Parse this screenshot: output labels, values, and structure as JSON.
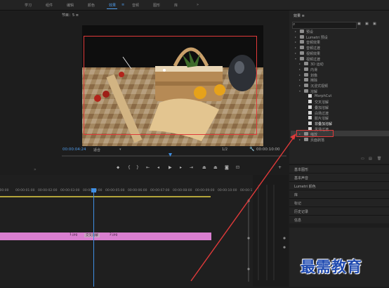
{
  "nav": {
    "items": [
      "学习",
      "组件",
      "编辑",
      "颜色",
      "效果",
      "音频",
      "图形",
      "库"
    ],
    "active": "效果",
    "more": "»"
  },
  "monitor": {
    "title": "节目：5  ≡",
    "timecode_current": "00:00:04:24",
    "fit_label": "适合",
    "resolution": "1/2",
    "timecode_total": "00:00:10:00"
  },
  "timeline": {
    "ruler_labels": [
      ":00:00",
      "00:00:01:00",
      "00:00:02:00",
      "00:00:03:00",
      "00:00:04:00",
      "00:00:05:00",
      "00:00:06:00",
      "00:00:07:00",
      "00:00:08:00",
      "00:00:09:00",
      "00:00:10:00",
      "00:00:11:00"
    ],
    "clip_labels": [
      "1.jpg",
      "交叉溶解",
      "2.jpg"
    ]
  },
  "effects": {
    "title": "效果  ≡",
    "tree": [
      {
        "label": "预设",
        "indent": 0,
        "type": "folder"
      },
      {
        "label": "Lumetri 预设",
        "indent": 0,
        "type": "folder"
      },
      {
        "label": "音频效果",
        "indent": 0,
        "type": "folder"
      },
      {
        "label": "音频过渡",
        "indent": 0,
        "type": "folder"
      },
      {
        "label": "视频效果",
        "indent": 0,
        "type": "folder"
      },
      {
        "label": "视频过渡",
        "indent": 0,
        "type": "folder-open"
      },
      {
        "label": "3D 运动",
        "indent": 1,
        "type": "folder"
      },
      {
        "label": "内滑",
        "indent": 1,
        "type": "folder"
      },
      {
        "label": "划像",
        "indent": 1,
        "type": "folder"
      },
      {
        "label": "擦除",
        "indent": 1,
        "type": "folder"
      },
      {
        "label": "沉浸式视频",
        "indent": 1,
        "type": "folder"
      },
      {
        "label": "溶解",
        "indent": 1,
        "type": "folder-open"
      },
      {
        "label": "MorphCut",
        "indent": 2,
        "type": "effect"
      },
      {
        "label": "交叉溶解",
        "indent": 2,
        "type": "effect"
      },
      {
        "label": "叠加溶解",
        "indent": 2,
        "type": "effect"
      },
      {
        "label": "白场过渡",
        "indent": 2,
        "type": "effect"
      },
      {
        "label": "胶片溶解",
        "indent": 2,
        "type": "effect"
      },
      {
        "label": "非叠加溶解",
        "indent": 2,
        "type": "effect",
        "selected": true
      },
      {
        "label": "黑场过渡",
        "indent": 2,
        "type": "effect"
      },
      {
        "label": "缩放",
        "indent": 1,
        "type": "folder"
      },
      {
        "label": "页面剥落",
        "indent": 1,
        "type": "folder"
      }
    ]
  },
  "side_panels": [
    "基本图形",
    "基本声音",
    "Lumetri 颜色",
    "库",
    "标记",
    "历史记录",
    "信息"
  ],
  "watermark": "最需教育",
  "colors": {
    "accent": "#4f9be8",
    "highlight_red": "#e03a3a",
    "clip_pink": "#d97fd0"
  }
}
